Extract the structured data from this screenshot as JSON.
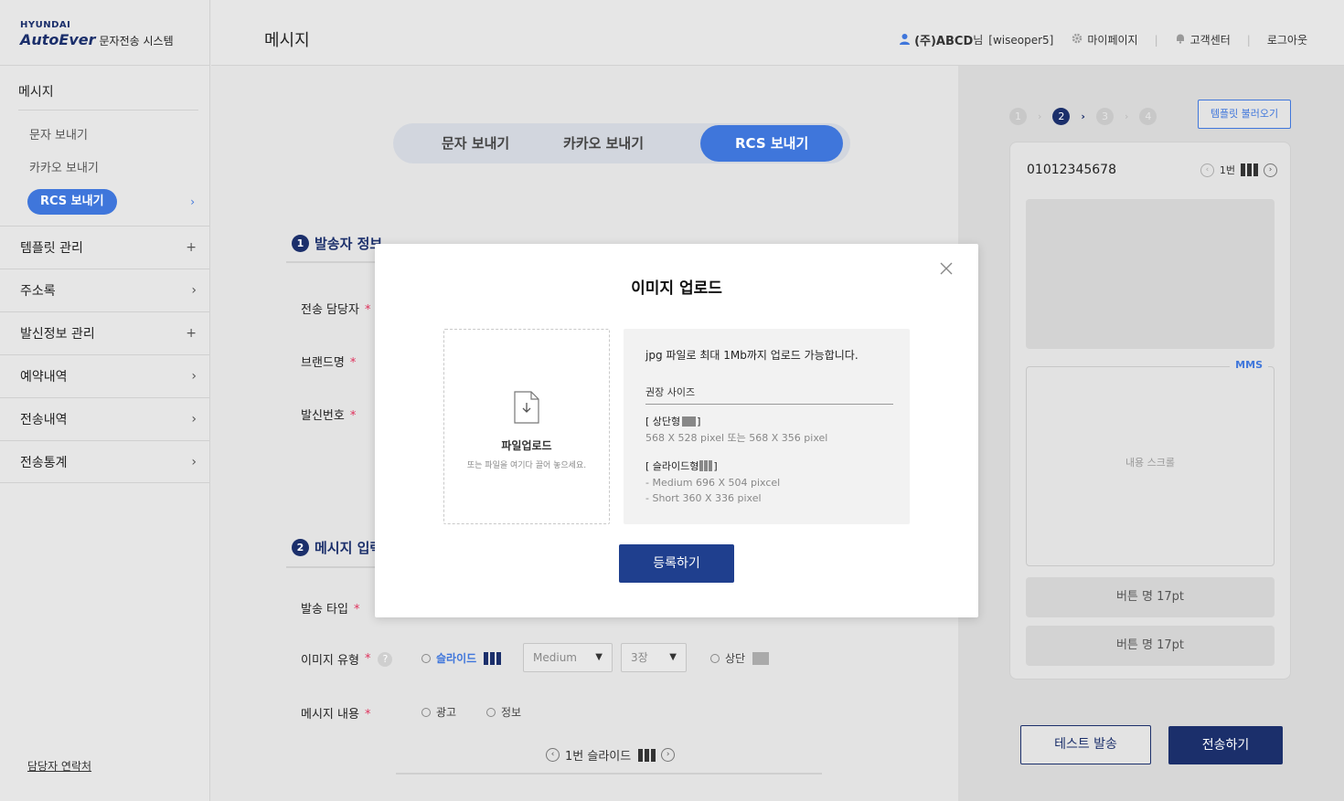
{
  "brand": {
    "hyundai": "HYUNDAI",
    "autoever": "AutoEver",
    "system": "문자전송 시스템"
  },
  "header": {
    "title": "메시지",
    "user_name": "(주)ABCD",
    "user_suffix": "님",
    "user_id": "[wiseoper5]",
    "mypage": "마이페이지",
    "support": "고객센터",
    "logout": "로그아웃"
  },
  "sidebar": {
    "section": "메시지",
    "sub_items": [
      "문자 보내기",
      "카카오 보내기",
      "RCS 보내기"
    ],
    "menu": [
      {
        "label": "템플릿 관리",
        "mark": "+"
      },
      {
        "label": "주소록",
        "mark": "›"
      },
      {
        "label": "발신정보 관리",
        "mark": "+"
      },
      {
        "label": "예약내역",
        "mark": "›"
      },
      {
        "label": "전송내역",
        "mark": "›"
      },
      {
        "label": "전송통계",
        "mark": "›"
      }
    ],
    "contact": "담당자 연락처"
  },
  "tabs": [
    "문자 보내기",
    "카카오 보내기",
    "RCS 보내기"
  ],
  "form": {
    "section1": {
      "num": "1",
      "title": "발송자 정보"
    },
    "section2": {
      "num": "2",
      "title": "메시지 입력"
    },
    "sender_label": "전송 담당자",
    "brand_label": "브랜드명",
    "number_label": "발신번호",
    "type_label": "발송 타입",
    "image_type_label": "이미지 유형",
    "content_label": "메시지 내용",
    "slide_option": "슬라이드",
    "size_select": "Medium",
    "count_select": "3장",
    "top_option": "상단",
    "ad_option": "광고",
    "info_option": "정보",
    "slide_nav": "1번 슬라이드",
    "required_mark": "*"
  },
  "preview": {
    "steps": [
      "1",
      "2",
      "3",
      "4"
    ],
    "active_step": 2,
    "template_button": "템플릿 불러오기",
    "phone_number": "01012345678",
    "slide_index": "1번",
    "mms_tag": "MMS",
    "scroll_text": "내용 스크롤",
    "button1": "버튼 명 17pt",
    "button2": "버튼 명 17pt",
    "test_send": "테스트 발송",
    "send": "전송하기"
  },
  "modal": {
    "title": "이미지 업로드",
    "upload_main": "파일업로드",
    "upload_sub": "또는 파일을 여기다 끌어 놓으세요.",
    "info_lead": "jpg 파일로 최대 1Mb까지 업로드 가능합니다.",
    "rec_size": "권장 사이즈",
    "top_type": "상단형",
    "top_size": "568 X 528 pixel 또는 568 X 356 pixel",
    "slide_type": "슬라이드형",
    "slide_medium": "- Medium 696 X 504 pixcel",
    "slide_short": "- Short 360 X 336 pixel",
    "register": "등록하기"
  }
}
